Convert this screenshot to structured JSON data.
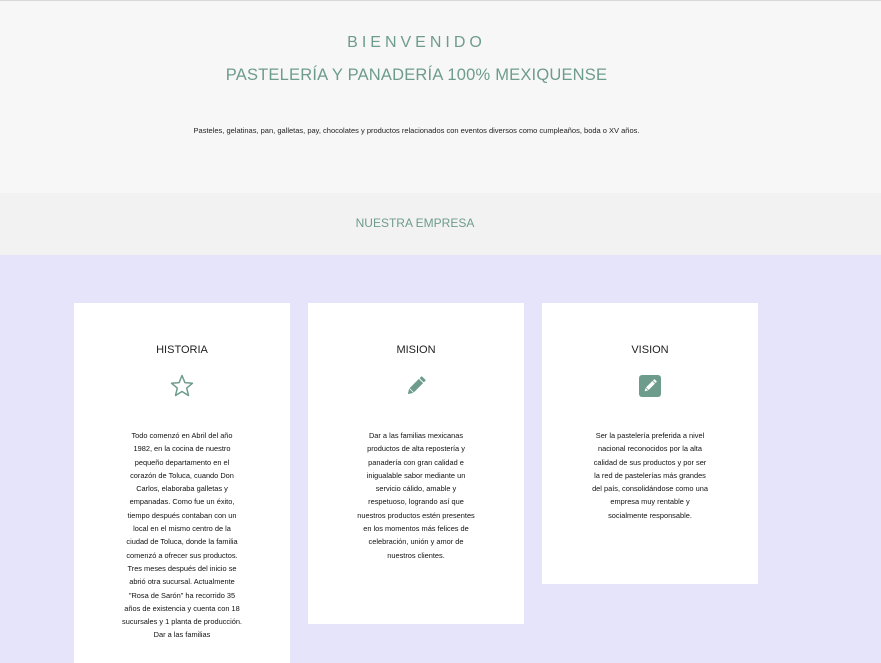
{
  "hero": {
    "kicker": "BIENVENIDO",
    "title": "PASTELERÍA Y PANADERÍA 100% MEXIQUENSE",
    "description": "Pasteles, gelatinas, pan, galletas, pay, chocolates y productos relacionados con eventos diversos como cumpleaños, boda o XV años."
  },
  "section": {
    "title": "NUESTRA EMPRESA"
  },
  "cards": [
    {
      "title": "HISTORIA",
      "icon": "star-outline-icon",
      "text": "Todo comenzó en Abril del año 1982, en la cocina de nuestro pequeño departamento en el corazón de Toluca, cuando Don Carlos, elaboraba galletas y empanadas. Como fue un éxito, tiempo después contaban con un local en el mismo centro de la ciudad de Toluca, donde la familia comenzó a ofrecer sus productos. Tres meses después del inicio se abrió otra sucursal. Actualmente \"Rosa de Sarón\" ha recorrido 35 años de existencia y cuenta con 18 sucursales y 1 planta de producción. Dar a las familias"
    },
    {
      "title": "MISION",
      "icon": "pencil-icon",
      "text": "Dar a las familias mexicanas productos de alta repostería y panadería con gran calidad e inigualable sabor mediante un servicio cálido, amable y respetuoso, logrando así que nuestros productos estén presentes en los momentos más felices de celebración, unión y amor de nuestros clientes."
    },
    {
      "title": "VISION",
      "icon": "pencil-square-icon",
      "text": "Ser la pastelería preferida a nivel nacional reconocidos por la alta calidad de sus productos y por ser la red de pastelerías más grandes del país, consolidándose como una empresa muy rentable y socialmente responsable."
    }
  ],
  "colors": {
    "accent": "#6e9c8c",
    "page_background": "#e5e4fa",
    "hero_background": "#f7f7f7",
    "band_background": "#f2f2f2",
    "card_background": "#ffffff"
  }
}
